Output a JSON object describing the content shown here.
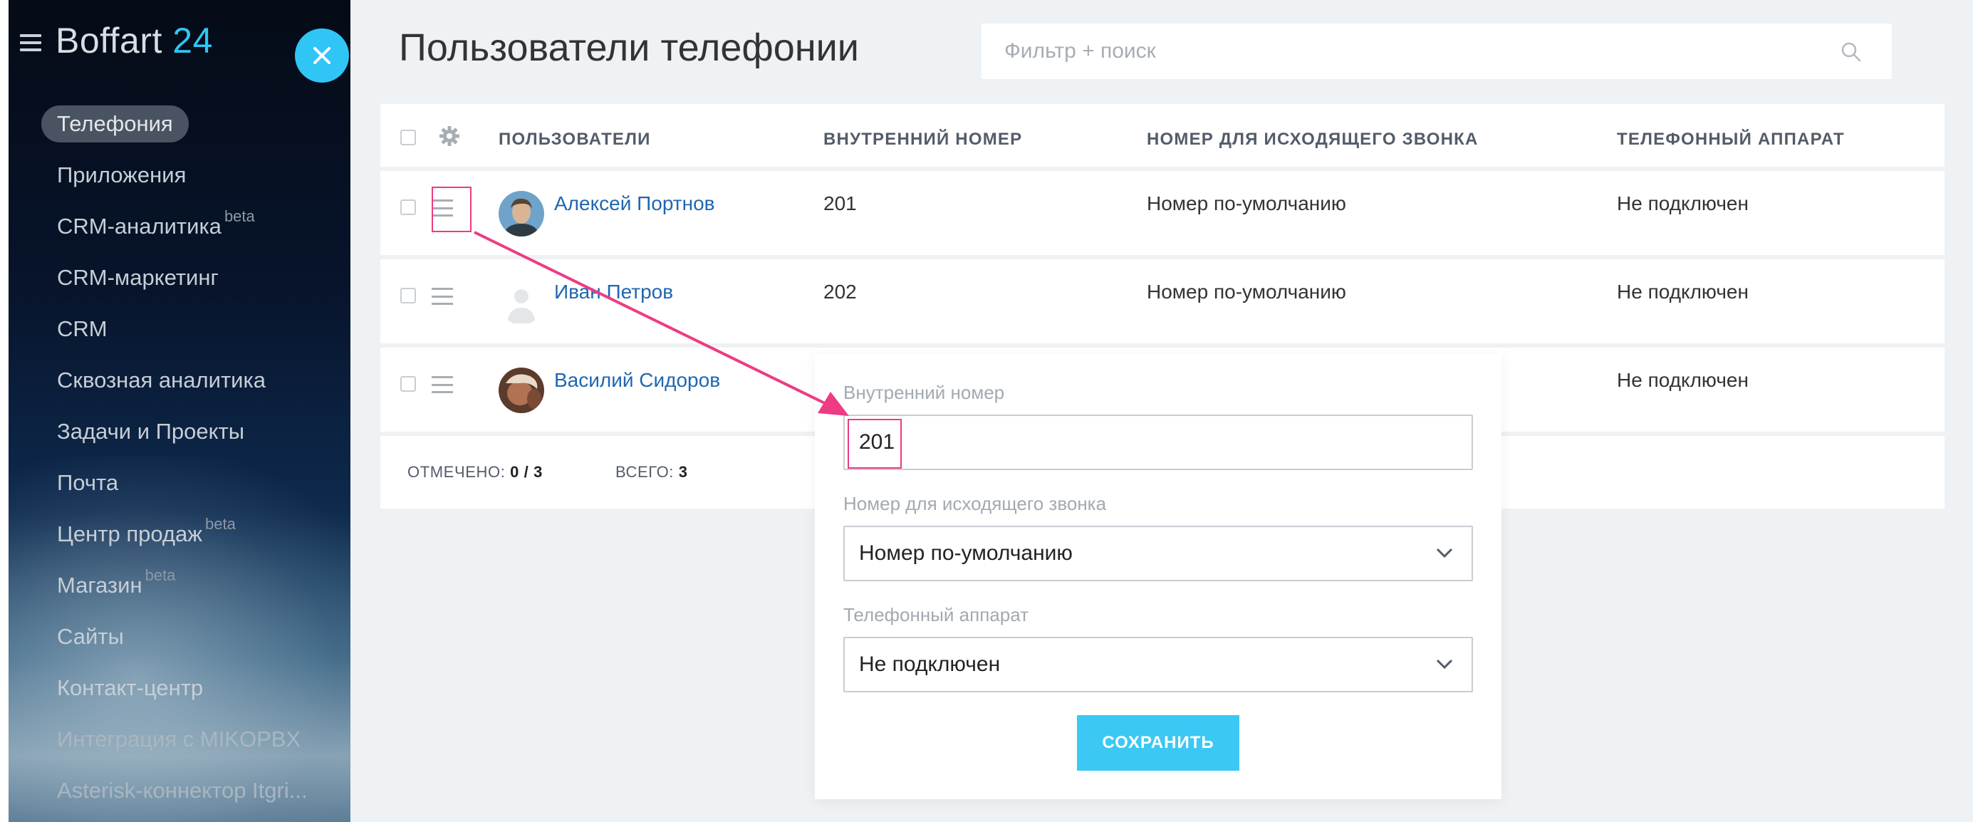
{
  "brand": {
    "name": "Boffart",
    "number": "24",
    "accent": "#2fc6f6"
  },
  "sidebar": {
    "items": [
      {
        "label": "Телефония",
        "active": true
      },
      {
        "label": "Приложения"
      },
      {
        "label": "CRM-аналитика",
        "badge": "beta"
      },
      {
        "label": "CRM-маркетинг"
      },
      {
        "label": "CRM"
      },
      {
        "label": "Сквозная аналитика"
      },
      {
        "label": "Задачи и Проекты"
      },
      {
        "label": "Почта"
      },
      {
        "label": "Центр продаж",
        "badge": "beta"
      },
      {
        "label": "Магазин",
        "badge": "beta"
      },
      {
        "label": "Сайты"
      },
      {
        "label": "Контакт-центр"
      },
      {
        "label": "Интеграция с MIKOPBX"
      },
      {
        "label": "Asterisk-коннектор Itgri..."
      }
    ]
  },
  "header": {
    "title": "Пользователи телефонии",
    "search_placeholder": "Фильтр + поиск"
  },
  "grid": {
    "columns": [
      "ПОЛЬЗОВАТЕЛИ",
      "ВНУТРЕННИЙ НОМЕР",
      "НОМЕР ДЛЯ ИСХОДЯЩЕГО ЗВОНКА",
      "ТЕЛЕФОННЫЙ АППАРАТ"
    ],
    "rows": [
      {
        "user": "Алексей Портнов",
        "ext": "201",
        "outgoing": "Номер по-умолчанию",
        "device": "Не подключен",
        "avatar": "photo-icon"
      },
      {
        "user": "Иван Петров",
        "ext": "202",
        "outgoing": "Номер по-умолчанию",
        "device": "Не подключен",
        "avatar": "user-placeholder-icon"
      },
      {
        "user": "Василий Сидоров",
        "ext": "",
        "outgoing": "",
        "device": "Не подключен",
        "avatar": "photo-icon"
      }
    ],
    "footer": {
      "selected_label": "ОТМЕЧЕНО:",
      "selected_value": "0 / 3",
      "total_label": "ВСЕГО:",
      "total_value": "3"
    }
  },
  "popup": {
    "ext_label": "Внутренний номер",
    "ext_value": "201",
    "outgoing_label": "Номер для исходящего звонка",
    "outgoing_value": "Номер по-умолчанию",
    "device_label": "Телефонный аппарат",
    "device_value": "Не подключен",
    "save_label": "СОХРАНИТЬ"
  },
  "colors": {
    "highlight": "#ee3b83",
    "link": "#2067b0",
    "button": "#3bc8f5"
  }
}
